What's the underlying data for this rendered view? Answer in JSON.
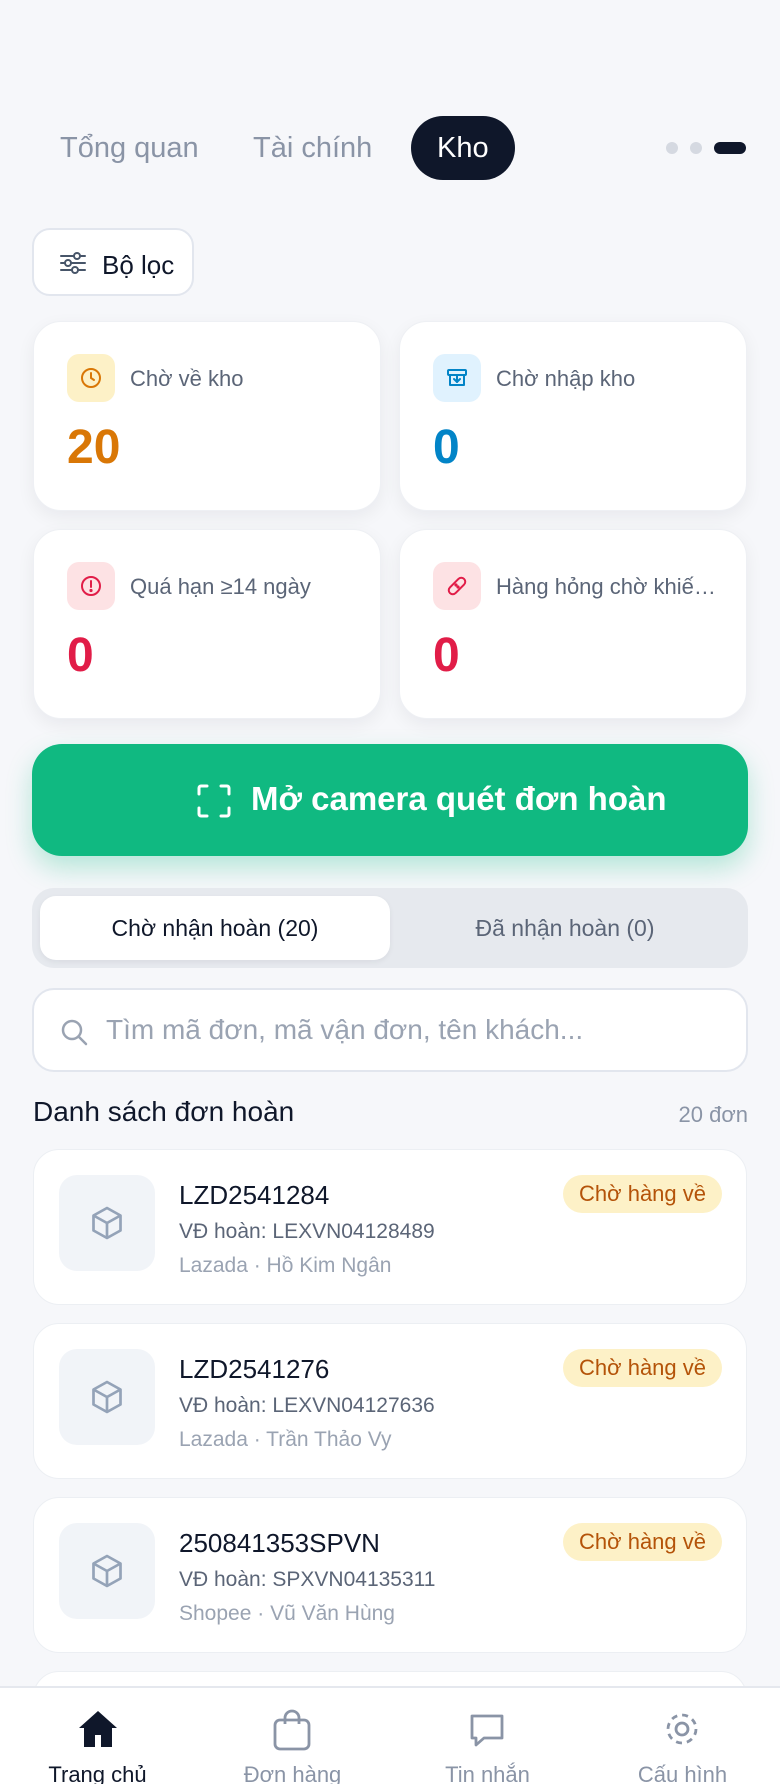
{
  "tabs": [
    {
      "label": "Tổng quan",
      "active": false
    },
    {
      "label": "Tài chính",
      "active": false
    },
    {
      "label": "Kho",
      "active": true
    }
  ],
  "filter": {
    "label": "Bộ lọc"
  },
  "stats": [
    {
      "label": "Chờ về kho",
      "value": "20",
      "color": "#d97706",
      "icon": "clock-icon"
    },
    {
      "label": "Chờ nhập kho",
      "value": "0",
      "color": "#0284c7",
      "icon": "archive-icon"
    },
    {
      "label": "Quá hạn ≥14 ngày",
      "value": "0",
      "color": "#e11d48",
      "icon": "alert-icon"
    },
    {
      "label": "Hàng hỏng chờ khiếu nại",
      "value": "0",
      "color": "#e11d48",
      "icon": "bandage-icon"
    }
  ],
  "scan": {
    "label": "Mở camera quét đơn hoàn"
  },
  "receive_tabs": [
    {
      "label": "Chờ nhận hoàn (20)",
      "active": true
    },
    {
      "label": "Đã nhận hoàn (0)",
      "active": false
    }
  ],
  "search": {
    "placeholder": "Tìm mã đơn, mã vận đơn, tên khách...",
    "value": ""
  },
  "list": {
    "title": "Danh sách đơn hoàn",
    "count": "20 đơn",
    "items": [
      {
        "code": "LZD2541284",
        "tracking": "VĐ hoàn: LEXVN04128489",
        "meta": "Lazada · Hồ Kim Ngân",
        "status": "Chờ hàng về"
      },
      {
        "code": "LZD2541276",
        "tracking": "VĐ hoàn: LEXVN04127636",
        "meta": "Lazada · Trần Thảo Vy",
        "status": "Chờ hàng về"
      },
      {
        "code": "250841353SPVN",
        "tracking": "VĐ hoàn: SPXVN04135311",
        "meta": "Shopee · Vũ Văn Hùng",
        "status": "Chờ hàng về"
      }
    ]
  },
  "nav": [
    {
      "label": "Trang chủ",
      "icon": "home-icon",
      "active": true
    },
    {
      "label": "Đơn hàng",
      "icon": "shopping-bag-icon",
      "active": false
    },
    {
      "label": "Tin nhắn",
      "icon": "chat-icon",
      "active": false
    },
    {
      "label": "Cấu hình",
      "icon": "gear-icon",
      "active": false
    }
  ],
  "colors": {
    "primary": "#10b981",
    "dark": "#0f172a",
    "badge_bg": "#fdf1c7",
    "badge_text": "#b45309"
  }
}
